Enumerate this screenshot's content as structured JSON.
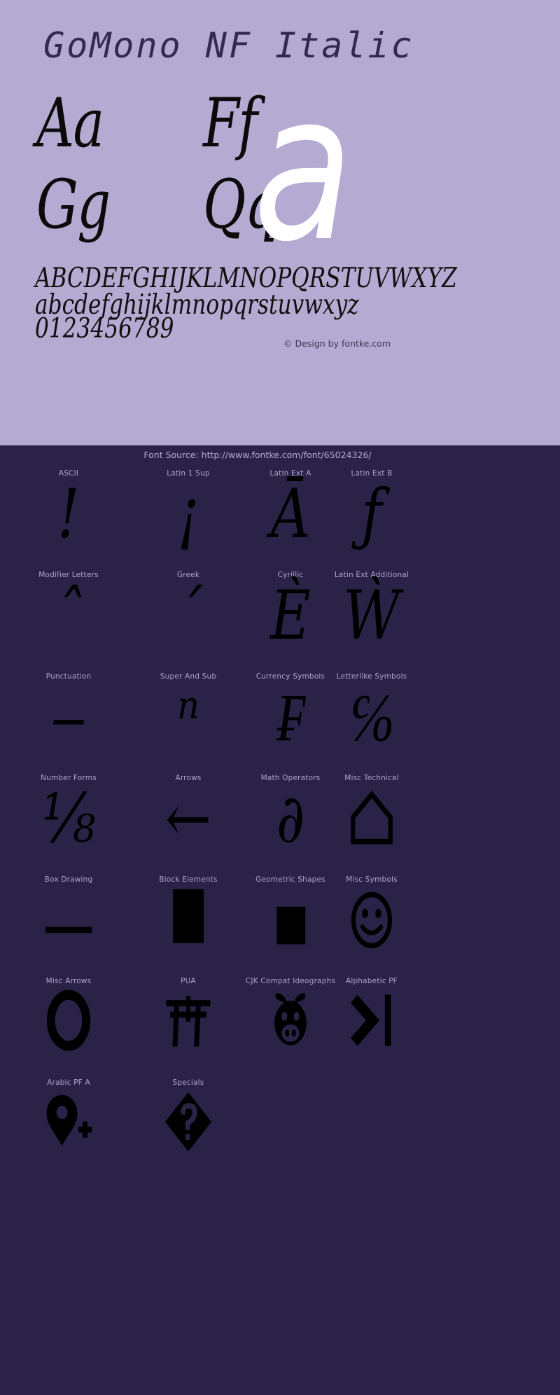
{
  "specimen": {
    "title": "GoMono NF Italic",
    "samples": [
      {
        "name": "sample-pair-aa",
        "text": "Aa"
      },
      {
        "name": "sample-pair-ff",
        "text": "Ff"
      },
      {
        "name": "sample-pair-gg",
        "text": "Gg"
      },
      {
        "name": "sample-pair-qq",
        "text": "Qq"
      }
    ],
    "hero_letter": "a",
    "alphabet_uppercase": "ABCDEFGHIJKLMNOPQRSTUVWXYZ",
    "alphabet_lowercase": "abcdefghijklmnopqrstuvwxyz",
    "digits": "0123456789",
    "credit": "© Design by fontke.com",
    "source": "Font Source: http://www.fontke.com/font/65024326/"
  },
  "colors": {
    "light_background": "#b5aad2",
    "dark_background": "#2b2247",
    "title_text": "#332a53",
    "glyph_black": "#000000",
    "hero_white": "#ffffff",
    "label_text": "#b0a5ca"
  },
  "glyph_blocks": [
    [
      {
        "label": "ASCII",
        "glyph": "!",
        "icon": null
      },
      {
        "label": "Latin 1 Sup",
        "glyph": "¡",
        "icon": null
      },
      {
        "label": "Latin Ext A",
        "glyph": "Ā",
        "icon": null
      },
      {
        "label": "Latin Ext B",
        "glyph": "ƒ",
        "icon": null
      }
    ],
    [
      {
        "label": "Modifier Letters",
        "glyph": "ˆ",
        "icon": null
      },
      {
        "label": "Greek",
        "glyph": "΄",
        "icon": null
      },
      {
        "label": "Cyrillic",
        "glyph": "Ѐ",
        "icon": null
      },
      {
        "label": "Latin Ext Additional",
        "glyph": "Ẁ",
        "icon": null
      }
    ],
    [
      {
        "label": "Punctuation",
        "glyph": "‒",
        "icon": null
      },
      {
        "label": "Super And Sub",
        "glyph": "ⁿ",
        "icon": null
      },
      {
        "label": "Currency Symbols",
        "glyph": "₣",
        "icon": null
      },
      {
        "label": "Letterlike Symbols",
        "glyph": "℅",
        "icon": null
      }
    ],
    [
      {
        "label": "Number Forms",
        "glyph": "⅛",
        "icon": null
      },
      {
        "label": "Arrows",
        "glyph": "←",
        "icon": null
      },
      {
        "label": "Math Operators",
        "glyph": "∂",
        "icon": null
      },
      {
        "label": "Misc Technical",
        "glyph": "",
        "icon": "house-outline-icon"
      }
    ],
    [
      {
        "label": "Box Drawing",
        "glyph": "",
        "icon": "horizontal-bar-icon"
      },
      {
        "label": "Block Elements",
        "glyph": "",
        "icon": "filled-block-icon"
      },
      {
        "label": "Geometric Shapes",
        "glyph": "",
        "icon": "filled-square-icon"
      },
      {
        "label": "Misc Symbols",
        "glyph": "",
        "icon": "smiley-face-icon"
      }
    ],
    [
      {
        "label": "Misc Arrows",
        "glyph": "",
        "icon": "heavy-circle-icon"
      },
      {
        "label": "PUA",
        "glyph": "",
        "icon": "torii-gate-icon"
      },
      {
        "label": "CJK Compat Ideographs",
        "glyph": "",
        "icon": "pig-face-icon"
      },
      {
        "label": "Alphabetic PF",
        "glyph": "",
        "icon": "skip-to-end-icon"
      }
    ],
    [
      {
        "label": "Arabic PF A",
        "glyph": "",
        "icon": "map-pin-plus-icon"
      },
      {
        "label": "Specials",
        "glyph": "",
        "icon": "replacement-character-icon"
      }
    ]
  ]
}
